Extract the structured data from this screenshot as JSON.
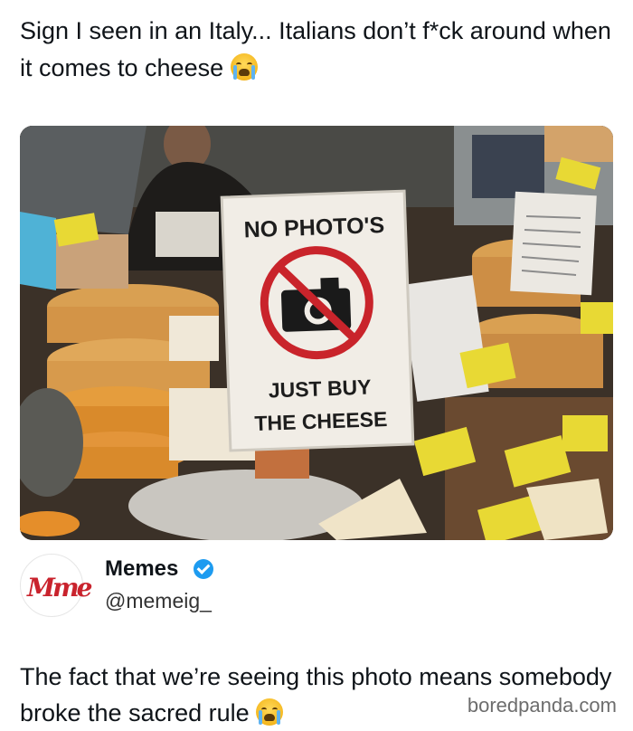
{
  "post": {
    "caption": "Sign I seen in an Italy... Italians don’t f*ck around when it comes to cheese",
    "caption_emoji": "loudly-crying-face"
  },
  "photo": {
    "sign_top": "NO PHOTO'S",
    "sign_bottom_line1": "JUST BUY",
    "sign_bottom_line2": "THE CHEESE",
    "colors": {
      "sign_bg": "#f1ede6",
      "prohibition_red": "#c9242b",
      "price_tag_yellow": "#e8d934",
      "cheese": "#d98a2b"
    }
  },
  "author": {
    "name": "Memes",
    "handle": "@memeig_",
    "avatar_text": "Mme",
    "verified": true,
    "avatar_color": "#c9232d",
    "verified_color": "#1d9bf0"
  },
  "reply": {
    "text": "The fact that we’re seeing this photo means somebody broke the sacred rule",
    "emoji": "loudly-crying-face"
  },
  "watermark": "boredpanda.com"
}
